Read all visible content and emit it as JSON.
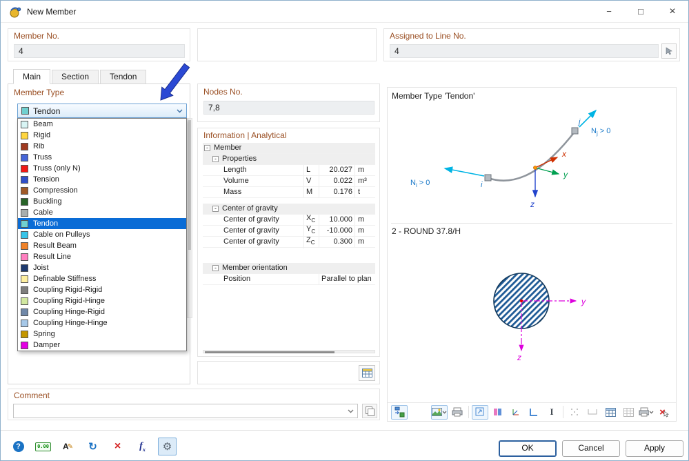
{
  "window": {
    "title": "New Member",
    "minimize": "−",
    "maximize": "□",
    "close": "×"
  },
  "top": {
    "member_no": {
      "label": "Member No.",
      "value": "4"
    },
    "assigned_line": {
      "label": "Assigned to Line No.",
      "value": "4"
    }
  },
  "tabs": {
    "main": "Main",
    "section": "Section",
    "tendon": "Tendon"
  },
  "member_type": {
    "label": "Member Type",
    "selected": "Tendon",
    "selected_color": "#70d0d0",
    "options": [
      {
        "label": "Beam",
        "color": "#d8f4f4"
      },
      {
        "label": "Rigid",
        "color": "#ffd640"
      },
      {
        "label": "Rib",
        "color": "#a03a20"
      },
      {
        "label": "Truss",
        "color": "#4666d8"
      },
      {
        "label": "Truss (only N)",
        "color": "#f01814"
      },
      {
        "label": "Tension",
        "color": "#3050c8"
      },
      {
        "label": "Compression",
        "color": "#a05a28"
      },
      {
        "label": "Buckling",
        "color": "#286428"
      },
      {
        "label": "Cable",
        "color": "#a8aeae"
      },
      {
        "label": "Tendon",
        "color": "#70d0d0"
      },
      {
        "label": "Cable on Pulleys",
        "color": "#38c4e8"
      },
      {
        "label": "Result Beam",
        "color": "#f08228"
      },
      {
        "label": "Result Line",
        "color": "#ff80c0"
      },
      {
        "label": "Joist",
        "color": "#1e3a6e"
      },
      {
        "label": "Definable Stiffness",
        "color": "#fff0a0"
      },
      {
        "label": "Coupling Rigid-Rigid",
        "color": "#7e7e7e"
      },
      {
        "label": "Coupling Rigid-Hinge",
        "color": "#d2e8a0"
      },
      {
        "label": "Coupling Hinge-Rigid",
        "color": "#7088a8"
      },
      {
        "label": "Coupling Hinge-Hinge",
        "color": "#a6c8e8"
      },
      {
        "label": "Spring",
        "color": "#c49600"
      },
      {
        "label": "Damper",
        "color": "#e400e4"
      }
    ]
  },
  "nodes": {
    "label": "Nodes No.",
    "value": "7,8"
  },
  "info": {
    "label": "Information | Analytical",
    "member": "Member",
    "properties": "Properties",
    "props": [
      {
        "name": "Length",
        "sym": "L",
        "value": "20.027",
        "unit": "m"
      },
      {
        "name": "Volume",
        "sym": "V",
        "value": "0.022",
        "unit": "m³"
      },
      {
        "name": "Mass",
        "sym": "M",
        "value": "0.176",
        "unit": "t"
      }
    ],
    "cog_header": "Center of gravity",
    "cog": [
      {
        "name": "Center of gravity",
        "sym": "X",
        "sub": "C",
        "value": "10.000",
        "unit": "m"
      },
      {
        "name": "Center of gravity",
        "sym": "Y",
        "sub": "C",
        "value": "-10.000",
        "unit": "m"
      },
      {
        "name": "Center of gravity",
        "sym": "Z",
        "sub": "C",
        "value": "0.300",
        "unit": "m"
      }
    ],
    "orientation_header": "Member orientation",
    "position": {
      "name": "Position",
      "value": "Parallel to plan"
    },
    "expander": "-"
  },
  "comment": {
    "label": "Comment",
    "value": ""
  },
  "graphic": {
    "title": "Member Type 'Tendon'",
    "node_i": "i",
    "node_j": "j",
    "ni": {
      "base": "N",
      "sub": "i",
      "rest": " > 0"
    },
    "nj": {
      "base": "N",
      "sub": "j",
      "rest": " > 0"
    },
    "axes": {
      "x": "x",
      "y": "y",
      "z": "z"
    },
    "section": {
      "title": "2 - ROUND 37.8/H",
      "axis_y": "y",
      "axis_z": "z"
    }
  },
  "footer": {
    "ok": "OK",
    "cancel": "Cancel",
    "apply": "Apply"
  },
  "glyphs": {
    "help": "?",
    "units": "0.00",
    "rename": "A",
    "pencil": "✎",
    "refresh": "↻",
    "delete": "×",
    "fn_base": "f",
    "fn_sub": "x",
    "gear": "⚙"
  }
}
